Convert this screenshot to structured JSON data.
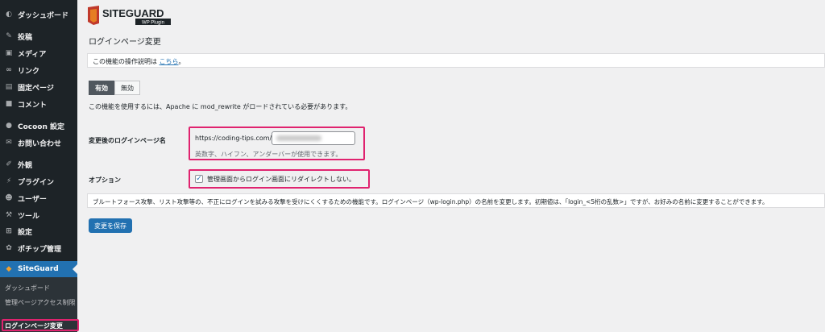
{
  "sidebar": {
    "items": [
      {
        "label": "ダッシュボード",
        "icon": "dashboard-icon"
      },
      {
        "label": "投稿",
        "icon": "pin-icon"
      },
      {
        "label": "メディア",
        "icon": "media-icon"
      },
      {
        "label": "リンク",
        "icon": "link-icon"
      },
      {
        "label": "固定ページ",
        "icon": "page-icon"
      },
      {
        "label": "コメント",
        "icon": "comment-icon"
      },
      {
        "label": "Cocoon 設定",
        "icon": "cocoon-icon"
      },
      {
        "label": "お問い合わせ",
        "icon": "mail-icon"
      },
      {
        "label": "外観",
        "icon": "brush-icon"
      },
      {
        "label": "プラグイン",
        "icon": "plugin-icon"
      },
      {
        "label": "ユーザー",
        "icon": "user-icon"
      },
      {
        "label": "ツール",
        "icon": "wrench-icon"
      },
      {
        "label": "設定",
        "icon": "settings-icon"
      },
      {
        "label": "ポチップ管理",
        "icon": "paw-icon"
      },
      {
        "label": "SiteGuard",
        "icon": "siteguard-icon"
      }
    ],
    "submenu": [
      "ダッシュボード",
      "管理ページアクセス制限",
      "ログインページ変更"
    ]
  },
  "logo": {
    "text": "SITEGUARD",
    "sub": "WP Plugin"
  },
  "page": {
    "title": "ログインページ変更",
    "notice_prefix": "この機能の操作説明は",
    "notice_link": "こちら",
    "notice_suffix": "。",
    "toggle_on": "有効",
    "toggle_off": "無効",
    "requirement": "この機能を使用するには、Apache に mod_rewrite がロードされている必要があります。",
    "login_name_label": "変更後のログインページ名",
    "url_prefix": "https://coding-tips.com/",
    "url_value": "",
    "hint": "英数字、ハイフン、アンダーバーが使用できます。",
    "option_label": "オプション",
    "option_checkbox": "管理画面からログイン画面にリダイレクトしない。",
    "info": "ブルートフォース攻撃、リスト攻撃等の、不正にログインを試みる攻撃を受けにくくするための機能です。ログインページ（wp-login.php）の名前を変更します。初期値は、「login_<5桁の乱数>」ですが、お好みの名前に変更することができます。",
    "save": "変更を保存"
  },
  "colors": {
    "accent": "#2271b1",
    "highlight": "#e0236f",
    "sidebar": "#1d2327"
  }
}
